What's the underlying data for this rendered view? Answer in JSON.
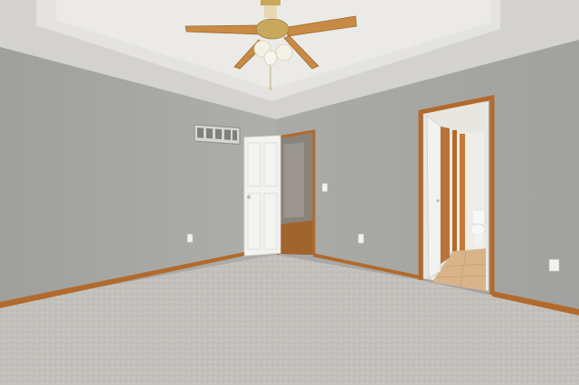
{
  "scene": {
    "kind": "photo",
    "subject": "empty-bedroom",
    "items": [
      "tray-ceiling",
      "ceiling-fan",
      "light-kit",
      "hvac-vent",
      "open-door",
      "closet-doorway",
      "bathroom-doorway",
      "toilet",
      "wall-switch",
      "outlets",
      "carpet-floor",
      "baseboards"
    ]
  },
  "colors": {
    "wall": "#a9aaa7",
    "wall_shadow": "#9b9c99",
    "ceiling": "#d9d8d4",
    "ceiling_recess": "#e6e5e1",
    "carpet": "#c4c1bd",
    "wood_trim": "#b26a2c",
    "fan_blade": "#c98a45",
    "fan_brass": "#c9a85b",
    "door": "#f3f3f1",
    "tile": "#d9b48a",
    "bath_wall": "#ecebe7"
  }
}
